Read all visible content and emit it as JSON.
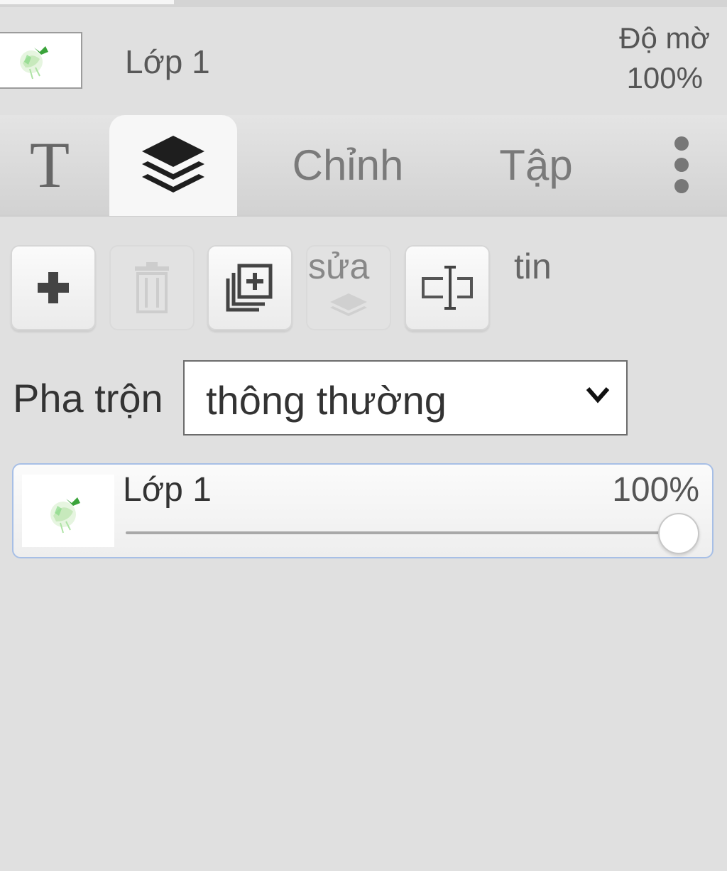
{
  "header": {
    "layer_name": "Lớp 1",
    "opacity_label": "Độ mờ",
    "opacity_value": "100%"
  },
  "tabs": [
    {
      "label": "T",
      "icon": "text-icon"
    },
    {
      "label": "",
      "icon": "layers-icon",
      "active": true
    },
    {
      "label": "Chỉnh"
    },
    {
      "label": "Tập"
    },
    {
      "label": "",
      "icon": "more-vertical-icon"
    }
  ],
  "toolbar": {
    "buttons": [
      {
        "icon": "plus-icon",
        "enabled": true
      },
      {
        "icon": "trash-icon",
        "enabled": false
      },
      {
        "icon": "duplicate-icon",
        "enabled": true
      },
      {
        "icon": "merge-layers-icon",
        "label": "sửa",
        "enabled": false
      },
      {
        "icon": "rename-icon",
        "enabled": true
      }
    ],
    "trailing_label": "tin"
  },
  "blend": {
    "label": "Pha trộn",
    "value": "thông thường"
  },
  "layers": [
    {
      "name": "Lớp 1",
      "opacity_text": "100%",
      "opacity": 1.0,
      "selected": true
    }
  ],
  "colors": {
    "accent_border": "#a7bfe6",
    "background": "#e0e0e0"
  }
}
